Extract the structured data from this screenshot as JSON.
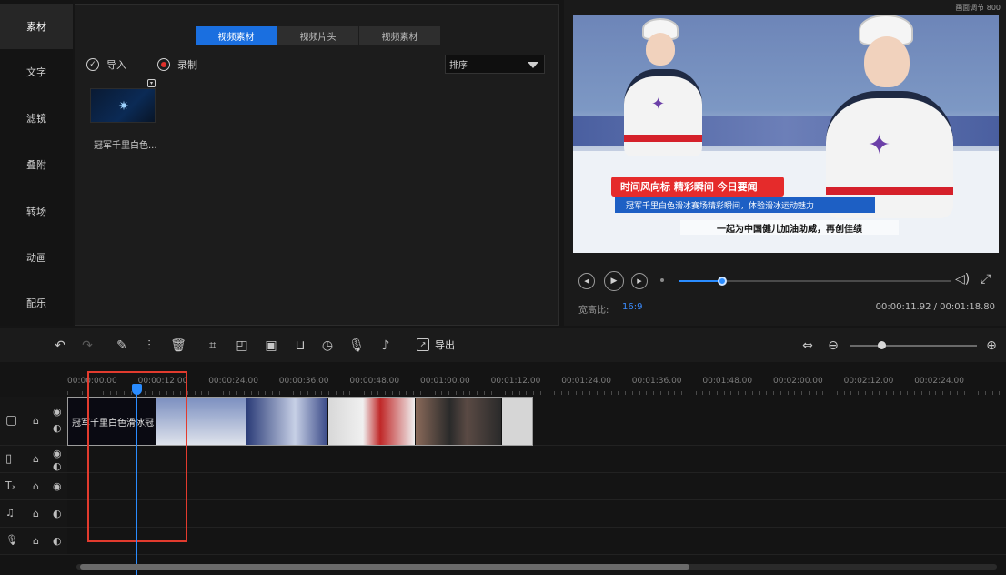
{
  "sidebar": {
    "items": [
      {
        "label": "素材",
        "active": true
      },
      {
        "label": "文字",
        "active": false
      },
      {
        "label": "滤镜",
        "active": false
      },
      {
        "label": "叠附",
        "active": false
      },
      {
        "label": "转场",
        "active": false
      },
      {
        "label": "动画",
        "active": false
      },
      {
        "label": "配乐",
        "active": false
      }
    ]
  },
  "material": {
    "tabs": [
      {
        "label": "视频素材",
        "active": true
      },
      {
        "label": "视频片头",
        "active": false
      },
      {
        "label": "视频素材",
        "active": false
      }
    ],
    "import_label": "导入",
    "record_label": "录制",
    "sort_value": "排序",
    "asset": {
      "name": "冠军千里白色..."
    }
  },
  "preview": {
    "top_label": "画面调节 800",
    "banner_red": "时间风向标 精彩瞬间 今日要闻",
    "banner_blue": "冠军千里白色滑冰赛场精彩瞬间，体验滑冰运动魅力",
    "caption": "一起为中国健儿加油助威，再创佳绩",
    "ratio_label": "宽高比:",
    "ratio_value": "16:9",
    "timecode": "00:00:11.92 / 00:01:18.80",
    "progress": 0.16
  },
  "toolbar": {
    "export_label": "导出",
    "zoom": 0.25
  },
  "timeline": {
    "ruler": [
      "00:00:00.00",
      "00:00:12.00",
      "00:00:24.00",
      "00:00:36.00",
      "00:00:48.00",
      "00:01:00.00",
      "00:01:12.00",
      "00:01:24.00",
      "00:01:36.00",
      "00:01:48.00",
      "00:02:00.00",
      "00:02:12.00",
      "00:02:24.00"
    ],
    "clip_title": "冠军千里白色滑冰冠",
    "track_count": 5
  },
  "colors": {
    "accent": "#1a6fe0",
    "highlight": "#e23b2e",
    "playhead": "#2a8cff"
  }
}
